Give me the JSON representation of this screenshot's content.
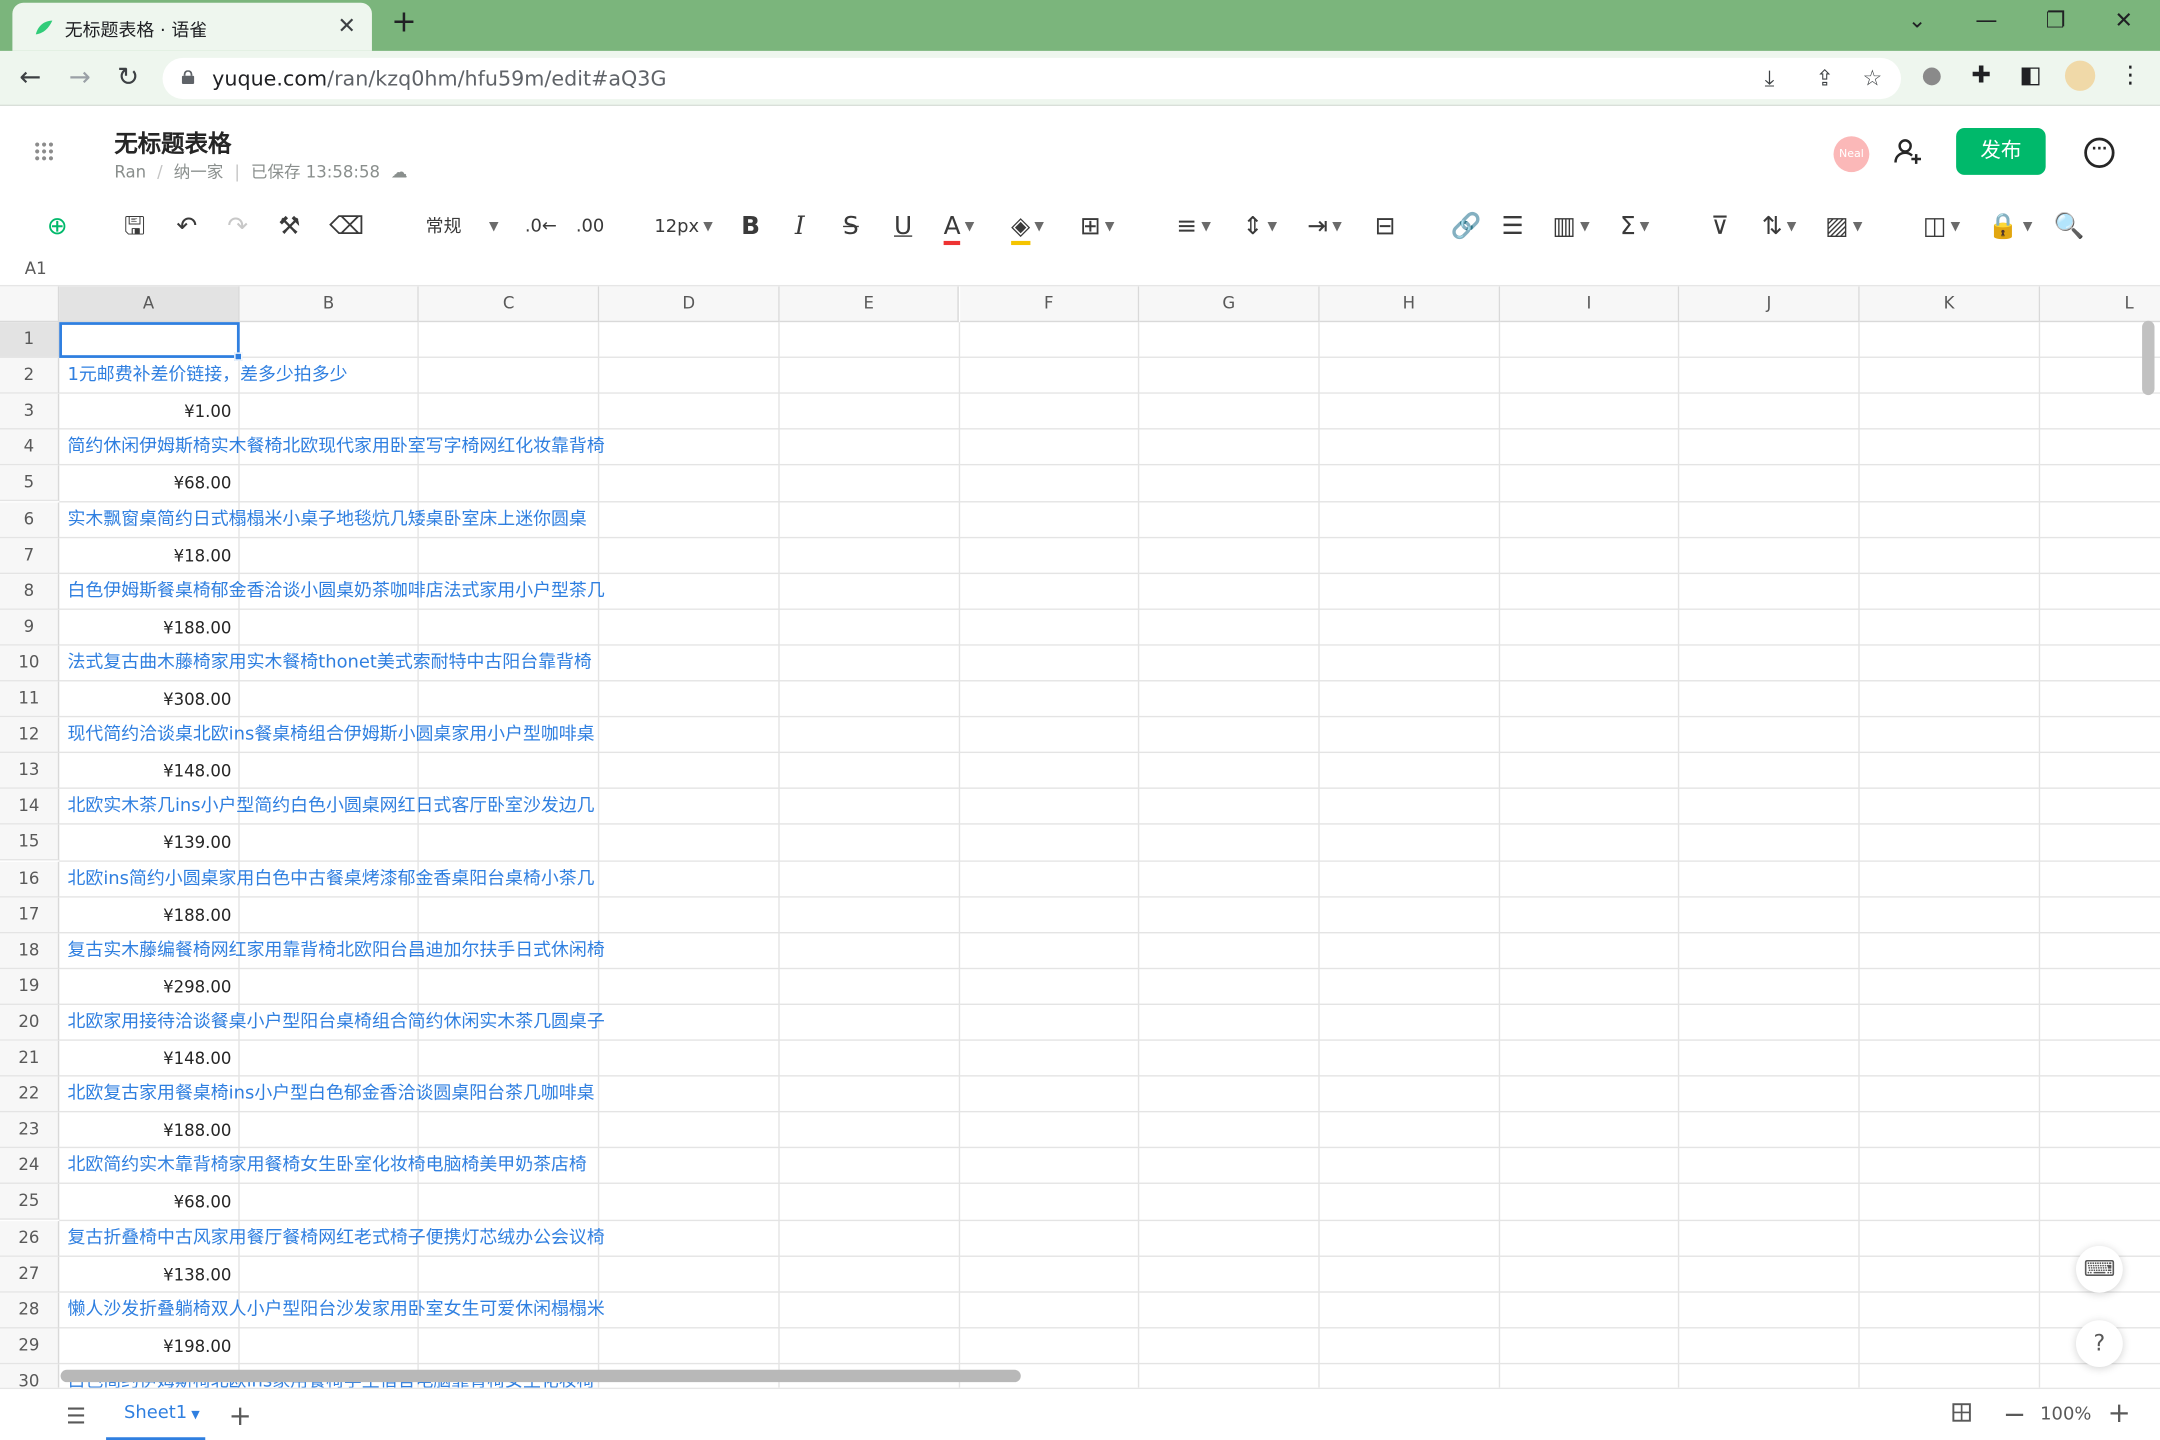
{
  "browser": {
    "tab_title": "无标题表格 · 语雀",
    "url_host": "yuque.com",
    "url_path": "/ran/kzq0hm/hfu59m/edit#aQ3G"
  },
  "doc": {
    "title": "无标题表格",
    "breadcrumb_user": "Ran",
    "breadcrumb_space": "纳一家",
    "save_status": "已保存 13:58:58",
    "publish_label": "发布",
    "avatar_text": "Neal"
  },
  "toolbar": {
    "format_label": "常规",
    "font_size": "12px"
  },
  "formula": {
    "cell_ref": "A1"
  },
  "grid": {
    "columns": [
      "A",
      "B",
      "C",
      "D",
      "E",
      "F",
      "G",
      "H",
      "I",
      "J",
      "K",
      "L"
    ],
    "rows": [
      {
        "n": "1",
        "kind": "empty",
        "a": ""
      },
      {
        "n": "2",
        "kind": "text",
        "a": "1元邮费补差价链接，差多少拍多少"
      },
      {
        "n": "3",
        "kind": "num",
        "a": "¥1.00"
      },
      {
        "n": "4",
        "kind": "text",
        "a": "简约休闲伊姆斯椅实木餐椅北欧现代家用卧室写字椅网红化妆靠背椅"
      },
      {
        "n": "5",
        "kind": "num",
        "a": "¥68.00"
      },
      {
        "n": "6",
        "kind": "text",
        "a": "实木飘窗桌简约日式榻榻米小桌子地毯炕几矮桌卧室床上迷你圆桌"
      },
      {
        "n": "7",
        "kind": "num",
        "a": "¥18.00"
      },
      {
        "n": "8",
        "kind": "text",
        "a": "白色伊姆斯餐桌椅郁金香洽谈小圆桌奶茶咖啡店法式家用小户型茶几"
      },
      {
        "n": "9",
        "kind": "num",
        "a": "¥188.00"
      },
      {
        "n": "10",
        "kind": "text",
        "a": "法式复古曲木藤椅家用实木餐椅thonet美式索耐特中古阳台靠背椅"
      },
      {
        "n": "11",
        "kind": "num",
        "a": "¥308.00"
      },
      {
        "n": "12",
        "kind": "text",
        "a": "现代简约洽谈桌北欧ins餐桌椅组合伊姆斯小圆桌家用小户型咖啡桌"
      },
      {
        "n": "13",
        "kind": "num",
        "a": "¥148.00"
      },
      {
        "n": "14",
        "kind": "text",
        "a": "北欧实木茶几ins小户型简约白色小圆桌网红日式客厅卧室沙发边几"
      },
      {
        "n": "15",
        "kind": "num",
        "a": "¥139.00"
      },
      {
        "n": "16",
        "kind": "text",
        "a": "北欧ins简约小圆桌家用白色中古餐桌烤漆郁金香桌阳台桌椅小茶几"
      },
      {
        "n": "17",
        "kind": "num",
        "a": "¥188.00"
      },
      {
        "n": "18",
        "kind": "text",
        "a": "复古实木藤编餐椅网红家用靠背椅北欧阳台昌迪加尔扶手日式休闲椅"
      },
      {
        "n": "19",
        "kind": "num",
        "a": "¥298.00"
      },
      {
        "n": "20",
        "kind": "text",
        "a": "北欧家用接待洽谈餐桌小户型阳台桌椅组合简约休闲实木茶几圆桌子"
      },
      {
        "n": "21",
        "kind": "num",
        "a": "¥148.00"
      },
      {
        "n": "22",
        "kind": "text",
        "a": "北欧复古家用餐桌椅ins小户型白色郁金香洽谈圆桌阳台茶几咖啡桌"
      },
      {
        "n": "23",
        "kind": "num",
        "a": "¥188.00"
      },
      {
        "n": "24",
        "kind": "text",
        "a": "北欧简约实木靠背椅家用餐椅女生卧室化妆椅电脑椅美甲奶茶店椅"
      },
      {
        "n": "25",
        "kind": "num",
        "a": "¥68.00"
      },
      {
        "n": "26",
        "kind": "text",
        "a": "复古折叠椅中古风家用餐厅餐椅网红老式椅子便携灯芯绒办公会议椅"
      },
      {
        "n": "27",
        "kind": "num",
        "a": "¥138.00"
      },
      {
        "n": "28",
        "kind": "text",
        "a": "懒人沙发折叠躺椅双人小户型阳台沙发家用卧室女生可爱休闲榻榻米"
      },
      {
        "n": "29",
        "kind": "num",
        "a": "¥198.00"
      },
      {
        "n": "30",
        "kind": "text",
        "a": "白色简约伊姆斯椅北欧ins家用餐椅学生宿舍电脑靠背椅女生化妆椅"
      }
    ]
  },
  "bottom": {
    "sheet_name": "Sheet1",
    "zoom": "100%"
  },
  "colors": {
    "browser_frame": "#7bb57c",
    "accent": "#00b96b",
    "link": "#2f7fe0"
  }
}
